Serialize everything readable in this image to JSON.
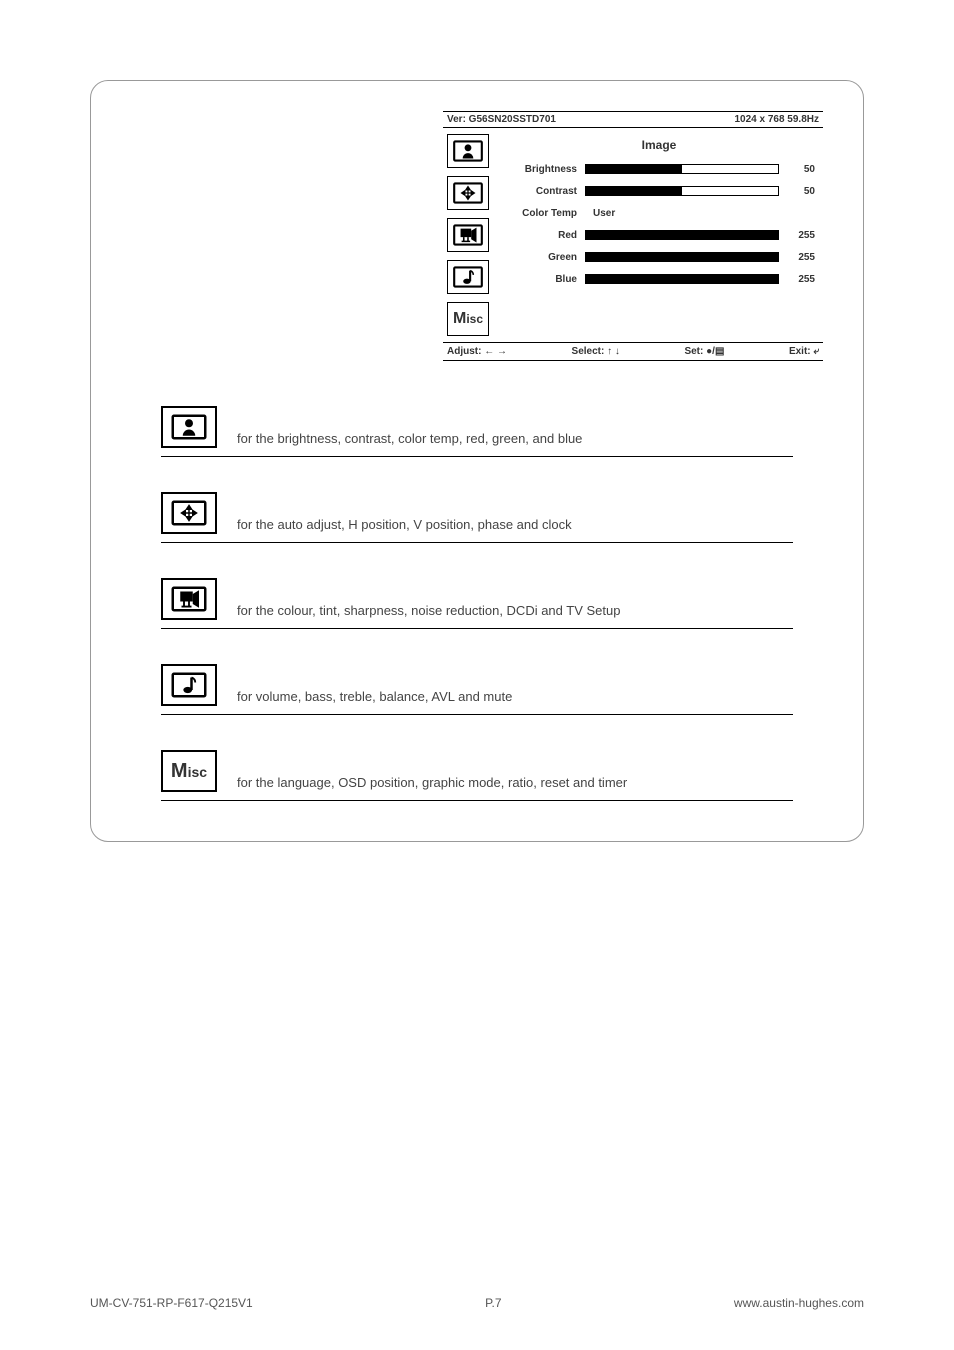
{
  "osd": {
    "version": "Ver: G56SN20SSTD701",
    "resolution": "1024 x 768  59.8Hz",
    "panel_title": "Image",
    "params": {
      "brightness": {
        "label": "Brightness",
        "value": 50,
        "max": 100
      },
      "contrast": {
        "label": "Contrast",
        "value": 50,
        "max": 100
      },
      "colortemp": {
        "label": "Color Temp",
        "user": "User"
      },
      "red": {
        "label": "Red",
        "value": 255,
        "max": 255
      },
      "green": {
        "label": "Green",
        "value": 255,
        "max": 255
      },
      "blue": {
        "label": "Blue",
        "value": 255,
        "max": 255
      }
    },
    "footer": {
      "adjust": "Adjust: ← →",
      "select": "Select: ↑ ↓",
      "set": "Set: ●/▤",
      "exit": "Exit: ⤶"
    }
  },
  "legend": {
    "image": "for the brightness, contrast, color temp, red, green, and blue",
    "position": "for the auto adjust, H position, V position, phase and clock",
    "video": "for the colour, tint, sharpness, noise reduction, DCDi and TV Setup",
    "audio": "for volume, bass, treble, balance, AVL and mute",
    "misc": "for the language, OSD position, graphic mode, ratio, reset and timer"
  },
  "misc_label": "Misc",
  "footer_left": "UM-CV-751-RP-F617-Q215V1",
  "footer_center": "P.7",
  "footer_right": "www.austin-hughes.com"
}
